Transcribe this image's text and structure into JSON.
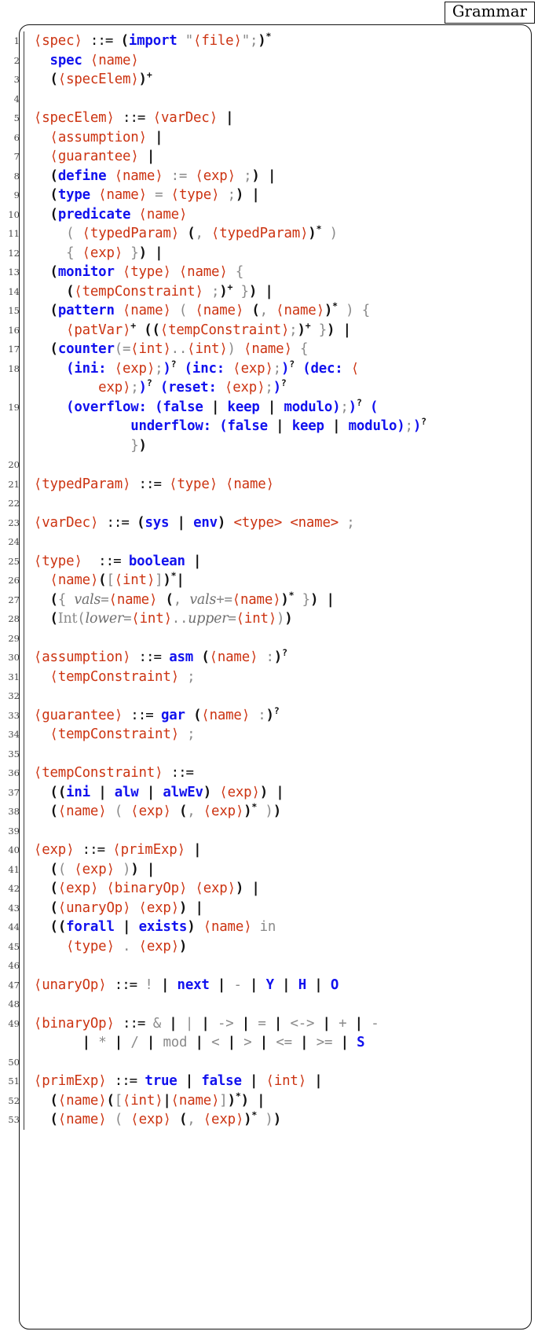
{
  "caption": {
    "label": "Grammar"
  },
  "listing": {
    "language": "Grammar specification (EBNF)",
    "first_line_number": 1,
    "last_line_number": 53,
    "colors": {
      "nonterminal": "#cc3311",
      "keyword": "#1111ee",
      "literal": "#8a8a8a",
      "grouping": "#111111",
      "line_number": "#4a4a4a",
      "frame": "#111111",
      "background": "#ffffff"
    },
    "lines": [
      {
        "n": "1",
        "text": "⟨spec⟩ ::= (import \"⟨file⟩\";)*"
      },
      {
        "n": "2",
        "text": "  spec ⟨name⟩"
      },
      {
        "n": "3",
        "text": "  (⟨specElem⟩)+"
      },
      {
        "n": "4",
        "text": ""
      },
      {
        "n": "5",
        "text": "⟨specElem⟩ ::= ⟨varDec⟩ |"
      },
      {
        "n": "6",
        "text": "  ⟨assumption⟩ |"
      },
      {
        "n": "7",
        "text": "  ⟨guarantee⟩ |"
      },
      {
        "n": "8",
        "text": "  (define ⟨name⟩ := ⟨exp⟩ ;) |"
      },
      {
        "n": "9",
        "text": "  (type ⟨name⟩ = ⟨type⟩ ;) |"
      },
      {
        "n": "10",
        "text": "  (predicate ⟨name⟩"
      },
      {
        "n": "11",
        "text": "    ( ⟨typedParam⟩ (, ⟨typedParam⟩)* )"
      },
      {
        "n": "12",
        "text": "    { ⟨exp⟩ }) |"
      },
      {
        "n": "13",
        "text": "  (monitor ⟨type⟩ ⟨name⟩ {"
      },
      {
        "n": "14",
        "text": "    (⟨tempConstraint⟩ ;)+ }) |"
      },
      {
        "n": "15",
        "text": "  (pattern ⟨name⟩ ( ⟨name⟩ (, ⟨name⟩)* ) {"
      },
      {
        "n": "16",
        "text": "    ⟨patVar⟩+ ((⟨tempConstraint⟩;)+ }) |"
      },
      {
        "n": "17",
        "text": "  (counter(=⟨int⟩..⟨int⟩) ⟨name⟩ {"
      },
      {
        "n": "18",
        "text": "    (ini: ⟨exp⟩;)? (inc: ⟨exp⟩;)? (dec: ⟨exp⟩;)? (reset: ⟨exp⟩;)?"
      },
      {
        "n": "19",
        "text": "    (overflow: (false | keep | modulo);)? ( underflow: (false | keep | modulo);)? })"
      },
      {
        "n": "20",
        "text": ""
      },
      {
        "n": "21",
        "text": "⟨typedParam⟩ ::= ⟨type⟩ ⟨name⟩"
      },
      {
        "n": "22",
        "text": ""
      },
      {
        "n": "23",
        "text": "⟨varDec⟩ ::= (sys | env) <type> <name> ;"
      },
      {
        "n": "24",
        "text": ""
      },
      {
        "n": "25",
        "text": "⟨type⟩ ::= boolean |"
      },
      {
        "n": "26",
        "text": "  ⟨name⟩([⟨int⟩])*|"
      },
      {
        "n": "27",
        "text": "  ({ vals=⟨name⟩ (, vals+=⟨name⟩)* }) |"
      },
      {
        "n": "28",
        "text": "  (Int(lower=⟨int⟩..upper=⟨int⟩))"
      },
      {
        "n": "29",
        "text": ""
      },
      {
        "n": "30",
        "text": "⟨assumption⟩ ::= asm (⟨name⟩ :)?"
      },
      {
        "n": "31",
        "text": "  ⟨tempConstraint⟩ ;"
      },
      {
        "n": "32",
        "text": ""
      },
      {
        "n": "33",
        "text": "⟨guarantee⟩ ::= gar (⟨name⟩ :)?"
      },
      {
        "n": "34",
        "text": "  ⟨tempConstraint⟩ ;"
      },
      {
        "n": "35",
        "text": ""
      },
      {
        "n": "36",
        "text": "⟨tempConstraint⟩ ::="
      },
      {
        "n": "37",
        "text": "  ((ini | alw | alwEv) ⟨exp⟩) |"
      },
      {
        "n": "38",
        "text": "  (⟨name⟩ ( ⟨exp⟩ (, ⟨exp⟩)* ))"
      },
      {
        "n": "39",
        "text": ""
      },
      {
        "n": "40",
        "text": "⟨exp⟩ ::= ⟨primExp⟩ |"
      },
      {
        "n": "41",
        "text": "  (( ⟨exp⟩ )) |"
      },
      {
        "n": "42",
        "text": "  (⟨exp⟩ ⟨binaryOp⟩ ⟨exp⟩) |"
      },
      {
        "n": "43",
        "text": "  (⟨unaryOp⟩ ⟨exp⟩) |"
      },
      {
        "n": "44",
        "text": "  ((forall | exists) ⟨name⟩ in"
      },
      {
        "n": "45",
        "text": "    ⟨type⟩ . ⟨exp⟩)"
      },
      {
        "n": "46",
        "text": ""
      },
      {
        "n": "47",
        "text": "⟨unaryOp⟩ ::= ! | next | - | Y | H | O"
      },
      {
        "n": "48",
        "text": ""
      },
      {
        "n": "49",
        "text": "⟨binaryOp⟩ ::= & | | | -> | = | <-> | + | - | * | / | mod | < | > | <= | >= | S"
      },
      {
        "n": "50",
        "text": ""
      },
      {
        "n": "51",
        "text": "⟨primExp⟩ ::= true | false | ⟨int⟩ |"
      },
      {
        "n": "52",
        "text": "  (⟨name⟩([⟨int⟩|⟨name⟩])*) |"
      },
      {
        "n": "53",
        "text": "  (⟨name⟩ ( ⟨exp⟩ (, ⟨exp⟩)* ))"
      }
    ],
    "keywords": [
      "import",
      "spec",
      "define",
      "type",
      "predicate",
      "monitor",
      "pattern",
      "counter",
      "ini",
      "inc",
      "dec",
      "reset",
      "overflow",
      "underflow",
      "false",
      "keep",
      "modulo",
      "sys",
      "env",
      "boolean",
      "asm",
      "gar",
      "alw",
      "alwEv",
      "forall",
      "exists",
      "next",
      "Y",
      "H",
      "O",
      "S",
      "true"
    ],
    "nonterminals": [
      "spec",
      "file",
      "name",
      "specElem",
      "varDec",
      "assumption",
      "guarantee",
      "exp",
      "type",
      "typedParam",
      "tempConstraint",
      "patVar",
      "int",
      "primExp",
      "binaryOp",
      "unaryOp"
    ]
  }
}
